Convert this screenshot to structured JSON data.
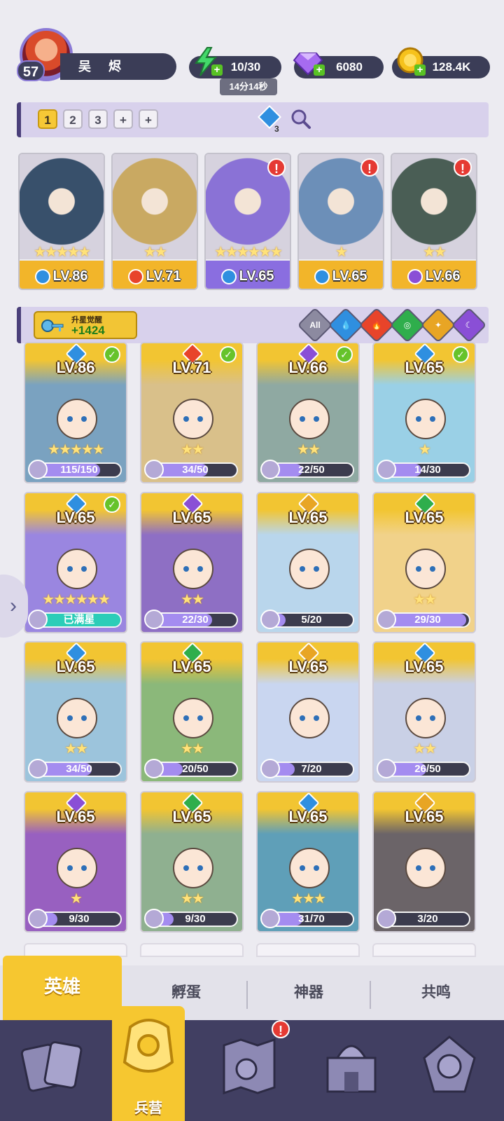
{
  "player": {
    "level": "57",
    "name": "吴 烬"
  },
  "resources": {
    "energy": "10/30",
    "energy_timer": "14分14秒",
    "gems": "6080",
    "coins": "128.4K"
  },
  "team": {
    "tabs": [
      "1",
      "2",
      "3",
      "+",
      "+"
    ],
    "active_tab": "1",
    "heroes": [
      {
        "level": "LV.86",
        "stars": "★★★★★",
        "element": "water",
        "alert": false
      },
      {
        "level": "LV.71",
        "stars": "★★",
        "element": "fire",
        "alert": false
      },
      {
        "level": "LV.65",
        "stars": "★★★★★★",
        "element": "water",
        "alert": true
      },
      {
        "level": "LV.65",
        "stars": "★",
        "element": "water",
        "alert": true
      },
      {
        "level": "LV.66",
        "stars": "★★",
        "element": "dark",
        "alert": true
      }
    ]
  },
  "filter": {
    "awaken_label": "升星觉醒",
    "awaken_value": "+1424",
    "all_label": "All"
  },
  "heroes": [
    {
      "level": "LV.86",
      "progress": "115/150",
      "ratio": 0.77,
      "stars": "★★★★★",
      "element": "water",
      "check": true
    },
    {
      "level": "LV.71",
      "progress": "34/50",
      "ratio": 0.68,
      "stars": "★★",
      "element": "fire",
      "check": true
    },
    {
      "level": "LV.66",
      "progress": "22/50",
      "ratio": 0.44,
      "stars": "★★",
      "element": "dark",
      "check": true
    },
    {
      "level": "LV.65",
      "progress": "14/30",
      "ratio": 0.47,
      "stars": "★",
      "element": "water",
      "check": true
    },
    {
      "level": "LV.65",
      "progress": "已满星",
      "ratio": 1.0,
      "stars": "★★★★★★",
      "element": "water",
      "check": true
    },
    {
      "level": "LV.65",
      "progress": "22/30",
      "ratio": 0.73,
      "stars": "★★",
      "element": "dark",
      "check": false
    },
    {
      "level": "LV.65",
      "progress": "5/20",
      "ratio": 0.25,
      "stars": "",
      "element": "light",
      "check": false
    },
    {
      "level": "LV.65",
      "progress": "29/30",
      "ratio": 0.97,
      "stars": "★★",
      "element": "wind",
      "check": false
    },
    {
      "level": "LV.65",
      "progress": "34/50",
      "ratio": 0.68,
      "stars": "★★",
      "element": "water",
      "check": false
    },
    {
      "level": "LV.65",
      "progress": "20/50",
      "ratio": 0.4,
      "stars": "★★",
      "element": "wind",
      "check": false
    },
    {
      "level": "LV.65",
      "progress": "7/20",
      "ratio": 0.35,
      "stars": "",
      "element": "light",
      "check": false
    },
    {
      "level": "LV.65",
      "progress": "26/50",
      "ratio": 0.52,
      "stars": "★★",
      "element": "water",
      "check": false
    },
    {
      "level": "LV.65",
      "progress": "9/30",
      "ratio": 0.3,
      "stars": "★",
      "element": "dark",
      "check": false
    },
    {
      "level": "LV.65",
      "progress": "9/30",
      "ratio": 0.3,
      "stars": "★★",
      "element": "wind",
      "check": false
    },
    {
      "level": "LV.65",
      "progress": "31/70",
      "ratio": 0.44,
      "stars": "★★★",
      "element": "water",
      "check": false
    },
    {
      "level": "LV.65",
      "progress": "3/20",
      "ratio": 0.15,
      "stars": "",
      "element": "light",
      "check": false
    }
  ],
  "sub_tabs": [
    "英雄",
    "孵蛋",
    "神器",
    "共鸣"
  ],
  "nav": {
    "active_label": "兵营"
  },
  "colors": {
    "water": "#2f8fe0",
    "fire": "#e8442a",
    "dark": "#8a4fd6",
    "light": "#e8a524",
    "wind": "#2fae4c",
    "accent": "#f6c730",
    "panel": "#d8d1ec"
  }
}
